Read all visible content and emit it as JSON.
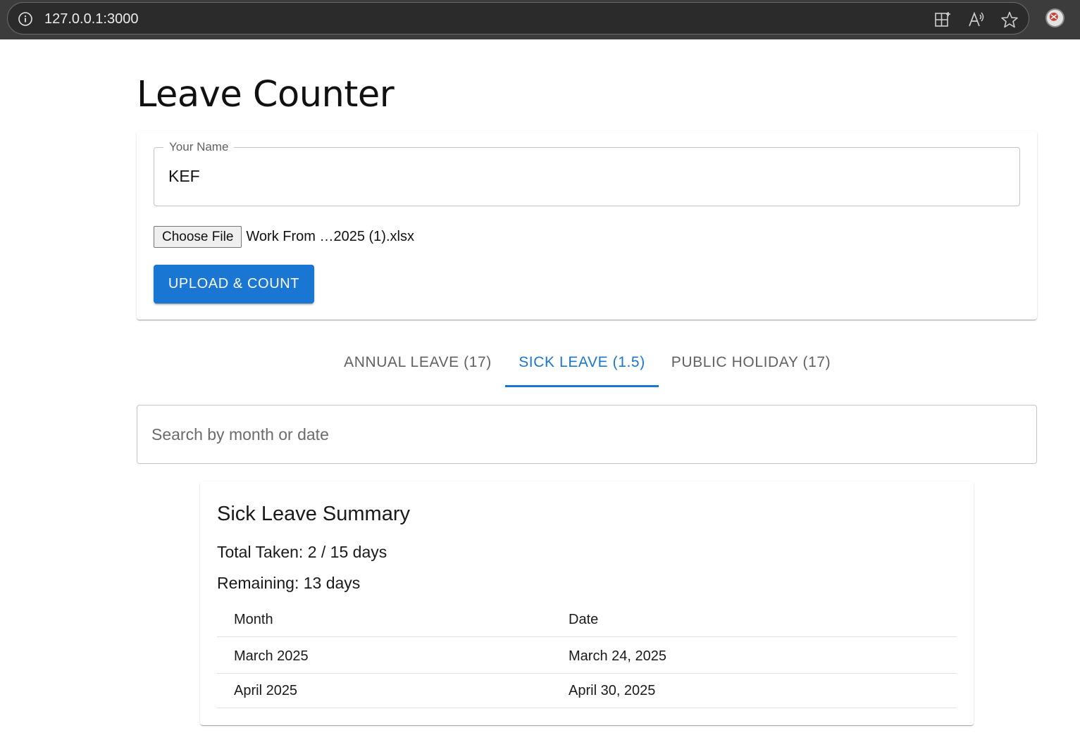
{
  "browser": {
    "url": "127.0.0.1:3000"
  },
  "page": {
    "title": "Leave Counter"
  },
  "upload_form": {
    "name_label": "Your Name",
    "name_value": "KEF",
    "choose_file_label": "Choose File",
    "file_name": "Work From …2025 (1).xlsx",
    "submit_label": "UPLOAD & COUNT"
  },
  "tabs": [
    {
      "label": "ANNUAL LEAVE (17)",
      "active": false
    },
    {
      "label": "SICK LEAVE (1.5)",
      "active": true
    },
    {
      "label": "PUBLIC HOLIDAY (17)",
      "active": false
    }
  ],
  "search": {
    "placeholder": "Search by month or date",
    "value": ""
  },
  "summary": {
    "title": "Sick Leave Summary",
    "total_taken": "Total Taken: 2 / 15 days",
    "remaining": "Remaining: 13 days",
    "columns": [
      "Month",
      "Date"
    ],
    "rows": [
      {
        "month": "March 2025",
        "date": "March 24, 2025"
      },
      {
        "month": "April 2025",
        "date": "April 30, 2025"
      }
    ]
  },
  "colors": {
    "primary": "#1976d2",
    "browser_bar": "#3c3c3c"
  }
}
